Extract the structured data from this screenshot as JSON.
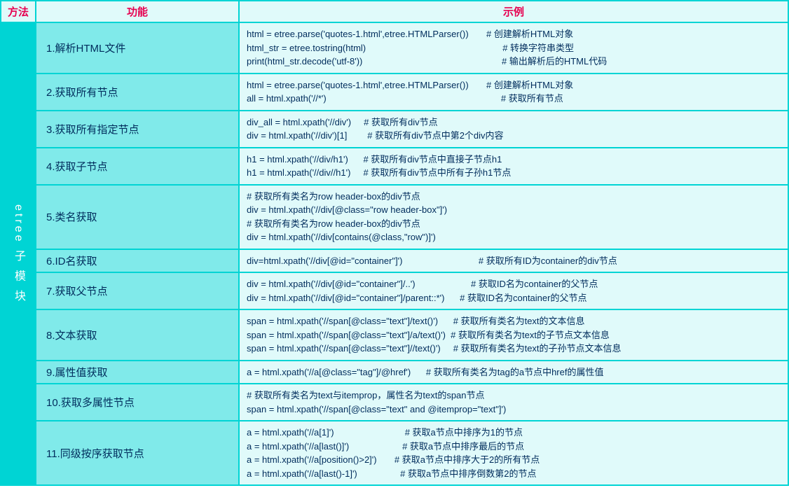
{
  "headers": {
    "method": "方法",
    "func": "功能",
    "example": "示例"
  },
  "methodLabel": "etree 子 模 块",
  "rows": [
    {
      "func": "1.解析HTML文件",
      "lines": [
        {
          "code": "html = etree.parse('quotes-1.html',etree.HTMLParser())",
          "spacer": "       ",
          "comment": "# 创建解析HTML对象"
        },
        {
          "code": "html_str = etree.tostring(html)",
          "spacer": "                                                      ",
          "comment": "# 转换字符串类型"
        },
        {
          "code": "print(html_str.decode('utf-8'))",
          "spacer": "                                                       ",
          "comment": "# 输出解析后的HTML代码"
        }
      ]
    },
    {
      "func": "2.获取所有节点",
      "lines": [
        {
          "code": "html = etree.parse('quotes-1.html',etree.HTMLParser())",
          "spacer": "       ",
          "comment": "# 创建解析HTML对象"
        },
        {
          "code": "all = html.xpath('//*')",
          "spacer": "                                                                     ",
          "comment": "# 获取所有节点"
        }
      ]
    },
    {
      "func": "3.获取所有指定节点",
      "lines": [
        {
          "code": "div_all = html.xpath('//div')",
          "spacer": "     ",
          "comment": "# 获取所有div节点"
        },
        {
          "code": "div = html.xpath('//div')[1]",
          "spacer": "        ",
          "comment": "# 获取所有div节点中第2个div内容"
        }
      ]
    },
    {
      "func": "4.获取子节点",
      "lines": [
        {
          "code": "h1 = html.xpath('//div/h1')",
          "spacer": "      ",
          "comment": "# 获取所有div节点中直接子节点h1"
        },
        {
          "code": "h1 = html.xpath('//div//h1')",
          "spacer": "     ",
          "comment": "# 获取所有div节点中所有子孙h1节点"
        }
      ]
    },
    {
      "func": "5.类名获取",
      "lines": [
        {
          "code": " # 获取所有类名为row header-box的div节点",
          "spacer": "",
          "comment": ""
        },
        {
          "code": "div = html.xpath('//div[@class=\"row header-box\"]')",
          "spacer": "",
          "comment": ""
        },
        {
          "code": "# 获取所有类名为row header-box的div节点",
          "spacer": "",
          "comment": ""
        },
        {
          "code": "div = html.xpath('//div[contains(@class,\"row\")]')",
          "spacer": "",
          "comment": ""
        }
      ]
    },
    {
      "func": "6.ID名获取",
      "lines": [
        {
          "code": "div=html.xpath('//div[@id=\"container\"]')",
          "spacer": "                              ",
          "comment": "# 获取所有ID为container的div节点"
        }
      ]
    },
    {
      "func": "7.获取父节点",
      "lines": [
        {
          "code": "div = html.xpath('//div[@id=\"container\"]/..')",
          "spacer": "                      ",
          "comment": "# 获取ID名为container的父节点"
        },
        {
          "code": "div = html.xpath('//div[@id=\"container\"]/parent::*')",
          "spacer": "      ",
          "comment": "# 获取ID名为container的父节点"
        }
      ]
    },
    {
      "func": "8.文本获取",
      "lines": [
        {
          "code": "span = html.xpath('//span[@class=\"text\"]/text()')",
          "spacer": "      ",
          "comment": "# 获取所有类名为text的文本信息"
        },
        {
          "code": "span = html.xpath('//span[@class=\"text\"]/a/text()')",
          "spacer": "  ",
          "comment": "# 获取所有类名为text的子节点文本信息"
        },
        {
          "code": "span = html.xpath('//span[@class=\"text\"]//text()')",
          "spacer": "     ",
          "comment": "# 获取所有类名为text的子孙节点文本信息"
        }
      ]
    },
    {
      "func": "9.属性值获取",
      "lines": [
        {
          "code": "a = html.xpath('//a[@class=\"tag\"]/@href')",
          "spacer": "      ",
          "comment": "# 获取所有类名为tag的a节点中href的属性值"
        }
      ]
    },
    {
      "func": "10.获取多属性节点",
      "lines": [
        {
          "code": "# 获取所有类名为text与itemprop，属性名为text的span节点",
          "spacer": "",
          "comment": ""
        },
        {
          "code": "span = html.xpath('//span[@class=\"text\" and @itemprop=\"text\"]')",
          "spacer": "",
          "comment": ""
        }
      ]
    },
    {
      "func": "11.同级按序获取节点",
      "lines": [
        {
          "code": "a = html.xpath('//a[1]')",
          "spacer": "                            ",
          "comment": "# 获取a节点中排序为1的节点"
        },
        {
          "code": "a = html.xpath('//a[last()]')",
          "spacer": "                     ",
          "comment": "# 获取a节点中排序最后的节点"
        },
        {
          "code": "a = html.xpath('//a[position()>2]')",
          "spacer": "       ",
          "comment": "# 获取a节点中排序大于2的所有节点"
        },
        {
          "code": "a = html.xpath('//a[last()-1]')",
          "spacer": "                 ",
          "comment": "# 获取a节点中排序倒数第2的节点"
        }
      ]
    }
  ]
}
